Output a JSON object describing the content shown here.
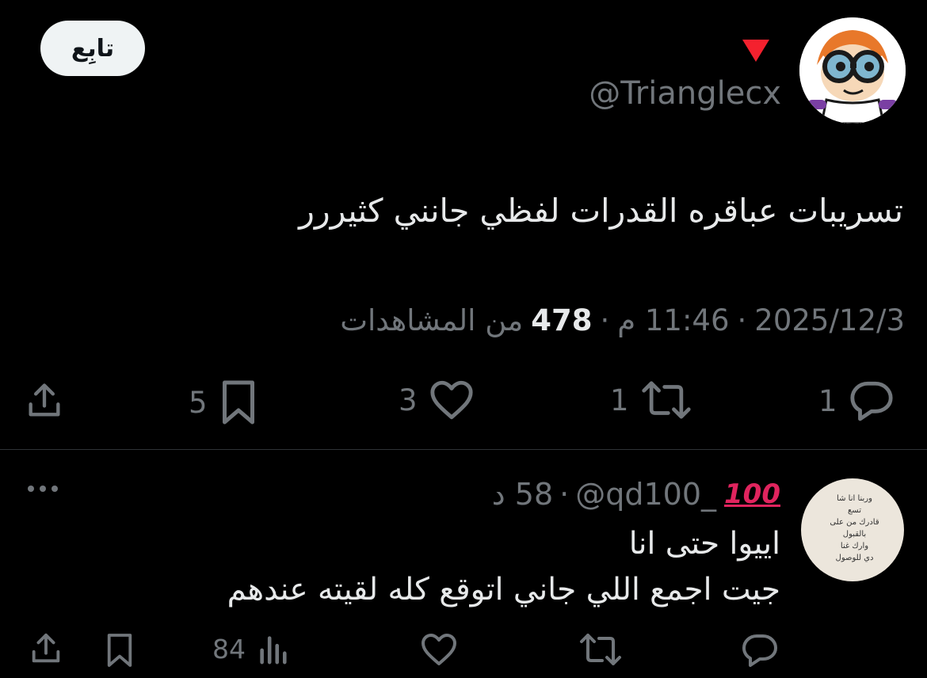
{
  "main_tweet": {
    "follow_label": "تابِع",
    "handle": "@Trianglecx",
    "text": "تسريبات عباقره القدرات لفظي جانني كثيررر",
    "date": "2025/12/3",
    "time": "11:46 م",
    "views_count": "478",
    "views_label": "من المشاهدات",
    "separator": "·",
    "actions": {
      "replies": "1",
      "reposts": "1",
      "likes": "3",
      "bookmarks": "5"
    }
  },
  "reply": {
    "badge": "100",
    "handle": "@qd100_",
    "time_ago": "58 د",
    "separator": "·",
    "lines": [
      "اييوا حتى انا",
      "جيت اجمع اللي جاني اتوقع كله لقيته عندهم"
    ],
    "actions": {
      "views": "84"
    },
    "avatar_text": [
      "وربنا انا شا",
      "تسع",
      "قادرك من على",
      "بالقبول",
      "وارك غنا",
      "دي للوصول"
    ]
  },
  "colors": {
    "background": "#000000",
    "text_primary": "#e7e9ea",
    "text_secondary": "#71767b",
    "divider": "#2f3336",
    "follow_bg": "#eff3f4",
    "triangle": "#f4212e"
  }
}
